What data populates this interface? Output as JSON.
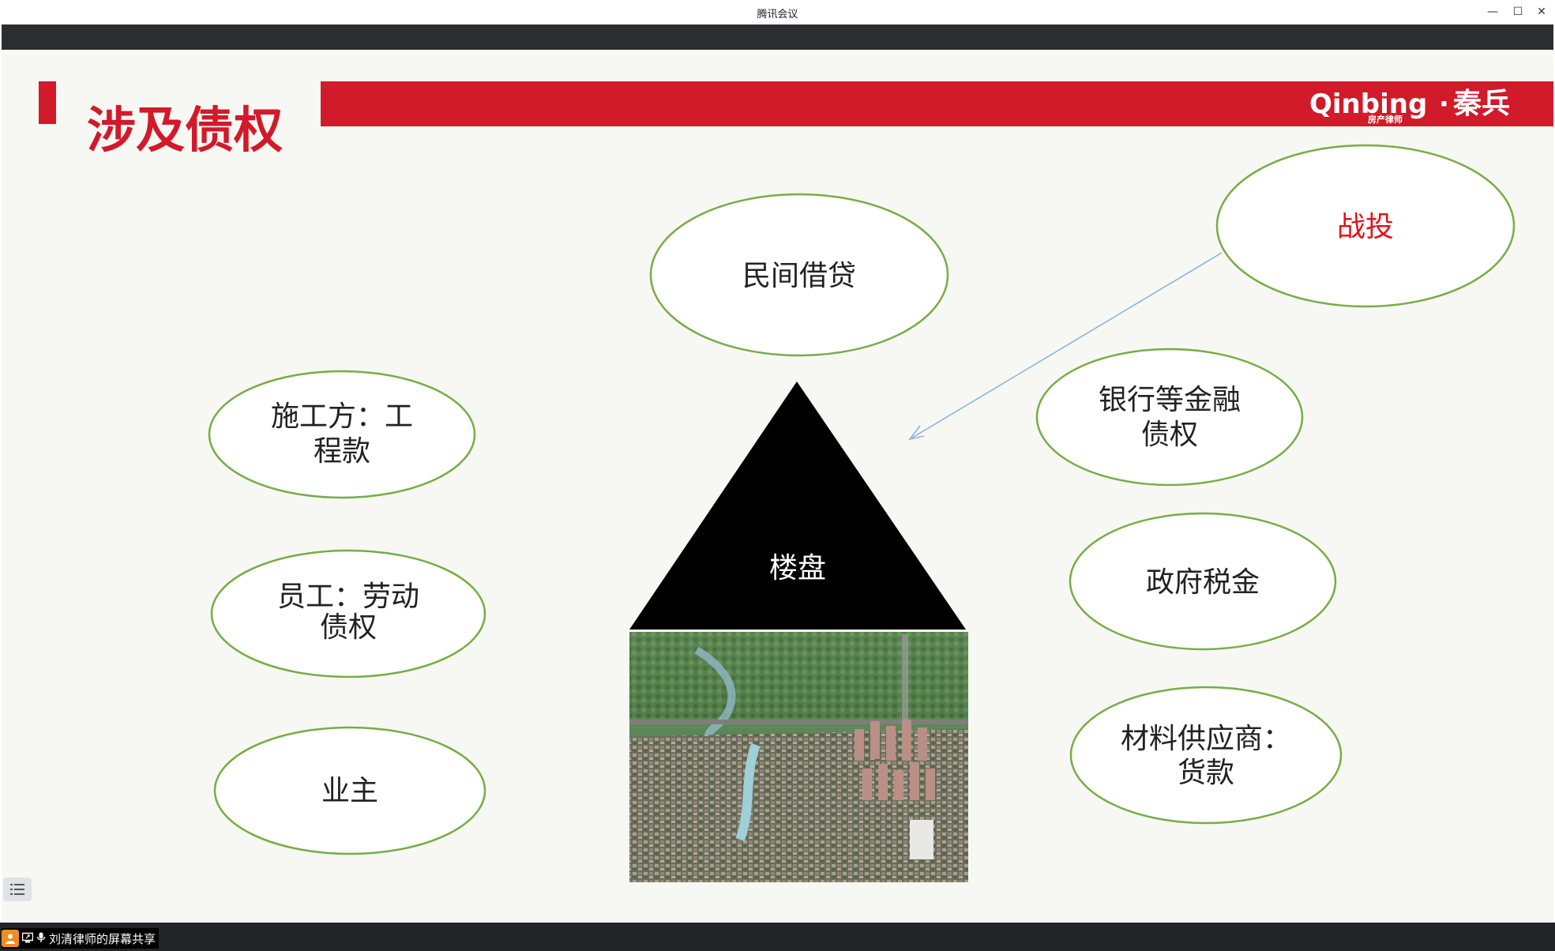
{
  "window": {
    "title": "腾讯会议",
    "minimize_glyph": "—",
    "maximize_glyph": "☐",
    "close_glyph": "✕"
  },
  "slide": {
    "title": "涉及债权",
    "brand_latin": "Qinbing",
    "brand_dot": "·",
    "brand_cn": "秦兵",
    "brand_sub": "房产律师",
    "center_label": "楼盘",
    "ellipses": {
      "minjian": [
        "民间借贷"
      ],
      "zhantou": [
        "战投"
      ],
      "bank": [
        "银行等金融",
        "债权"
      ],
      "contractor": [
        "施工方：工",
        "程款"
      ],
      "employee": [
        "员工：劳动",
        "债权"
      ],
      "owner": [
        "业主"
      ],
      "tax": [
        "政府税金"
      ],
      "supplier": [
        "材料供应商：",
        "货款"
      ]
    },
    "image_label": "residential-estate-aerial-photo"
  },
  "footer": {
    "share_text": "刘清律师的屏幕共享"
  },
  "colors": {
    "brand_red": "#d11a2a",
    "ellipse_stroke": "#77ad45",
    "highlight_red": "#e0141e",
    "arrow": "#8fb4d8"
  },
  "icons": [
    "user-icon",
    "screen-share-icon",
    "microphone-icon",
    "toc-list-icon",
    "minimize-icon",
    "maximize-icon",
    "close-icon"
  ]
}
